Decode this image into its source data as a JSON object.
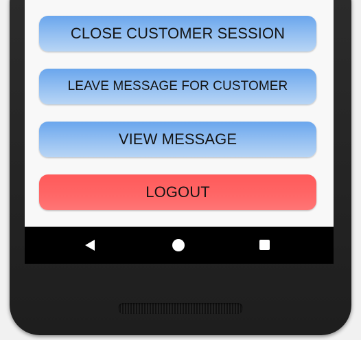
{
  "buttons": {
    "close_session": "CLOSE CUSTOMER SESSION",
    "leave_message": "LEAVE MESSAGE FOR CUSTOMER",
    "view_message": "VIEW MESSAGE",
    "logout": "LOGOUT"
  },
  "colors": {
    "button_blue_top": "#6aa6ed",
    "button_blue_bottom": "#b8d5f5",
    "logout_red": "#ff5a5a",
    "nav_bar": "#000000",
    "phone_body": "#2c2c2c"
  },
  "navigation": {
    "back_icon": "back-triangle-icon",
    "home_icon": "home-circle-icon",
    "recents_icon": "recents-square-icon"
  }
}
